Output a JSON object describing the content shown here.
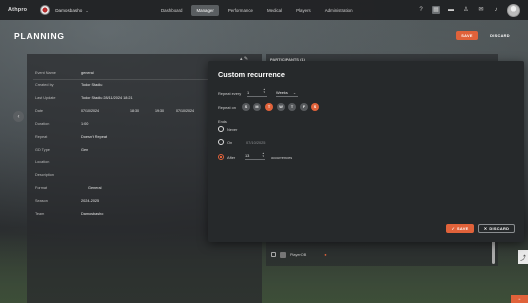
{
  "nav": {
    "logo": "Αthpro",
    "team": "Damosbasho",
    "links": [
      {
        "label": "Dashboard"
      },
      {
        "label": "Manager"
      },
      {
        "label": "Performance"
      },
      {
        "label": "Medical"
      },
      {
        "label": "Players"
      },
      {
        "label": "Administration"
      }
    ]
  },
  "header": {
    "title": "PLANNING",
    "save": "SAVE",
    "discard": "DISCARD"
  },
  "form": {
    "fields": [
      {
        "label": "Event Name",
        "value": "general"
      },
      {
        "label": "Created by",
        "value": "Todor Stadiu"
      },
      {
        "label": "Last Update",
        "value": "Todor Stadiu 28/11/2024 18:21"
      },
      {
        "label": "Date",
        "value": "07/10/2024"
      },
      {
        "label": "Duration",
        "value": "1:00"
      },
      {
        "label": "Repeat",
        "value": "Doesn't Repeat"
      },
      {
        "label": "GD Type",
        "value": "Gen"
      },
      {
        "label": "Location",
        "value": ""
      },
      {
        "label": "Description",
        "value": ""
      },
      {
        "label": "Format",
        "value": "General"
      },
      {
        "label": "Season",
        "value": "2024-2025"
      },
      {
        "label": "Team",
        "value": "Damosbasho"
      }
    ],
    "date_time_start": "18:30",
    "date_time_end": "19:30",
    "date_end": "07/10/2024"
  },
  "participants": {
    "title": "PARTICIPANTS (1)",
    "player": "PlayerOB"
  },
  "modal": {
    "title": "Custom recurrence",
    "repeat_every_label": "Repeat every",
    "repeat_every_value": "1",
    "repeat_unit": "Weeks",
    "repeat_on_label": "Repeat on",
    "days": [
      {
        "letter": "S",
        "selected": false
      },
      {
        "letter": "M",
        "selected": false
      },
      {
        "letter": "T",
        "selected": true
      },
      {
        "letter": "W",
        "selected": false
      },
      {
        "letter": "T",
        "selected": false
      },
      {
        "letter": "F",
        "selected": false
      },
      {
        "letter": "S",
        "selected": true
      }
    ],
    "ends_label": "Ends",
    "never_label": "Never",
    "on_label": "On",
    "on_date": "07/10/2025",
    "after_label": "After",
    "after_value": "13",
    "occurrences_label": "occurrences",
    "ends_selected": "after",
    "save": "SAVE",
    "discard": "DISCARD"
  },
  "colors": {
    "accent": "#e0623a",
    "modal_bg": "#26292b",
    "nav_bg": "#1e2022"
  },
  "icons": [
    "help-icon",
    "calendar-icon",
    "folder-icon",
    "user-icon",
    "chat-icon",
    "bell-icon",
    "chevron-left-icon",
    "chevron-down-icon",
    "check-icon",
    "close-icon"
  ]
}
